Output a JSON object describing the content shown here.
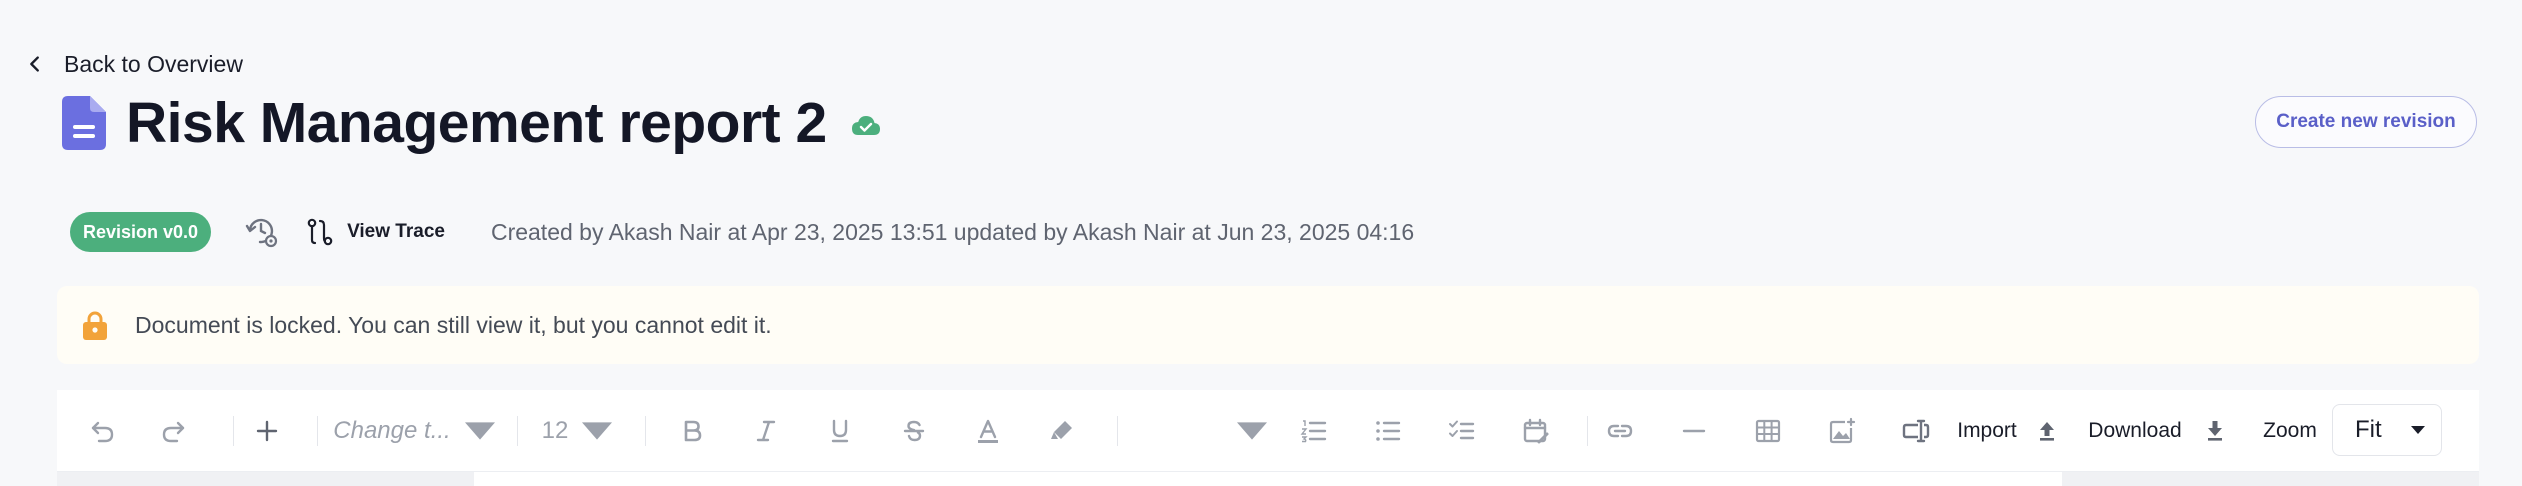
{
  "nav": {
    "back_label": "Back to Overview"
  },
  "document": {
    "title": "Risk Management report 2",
    "create_revision_label": "Create new revision"
  },
  "meta": {
    "revision_badge": "Revision v0.0",
    "view_trace_label": "View Trace",
    "info_text": "Created by Akash Nair at Apr 23, 2025 13:51 updated by Akash Nair at Jun 23, 2025 04:16"
  },
  "banner": {
    "message": "Document is locked. You can still view it, but you cannot edit it."
  },
  "toolbar": {
    "font_placeholder": "Change t...",
    "font_size": "12",
    "import_label": "Import",
    "download_label": "Download",
    "zoom_label": "Zoom",
    "zoom_value": "Fit"
  },
  "colors": {
    "accent": "#5a5fc8",
    "doc_icon": "#6b6fe0",
    "success": "#4caf7d",
    "lock": "#f2a33a",
    "banner_bg": "#fffdf6"
  }
}
